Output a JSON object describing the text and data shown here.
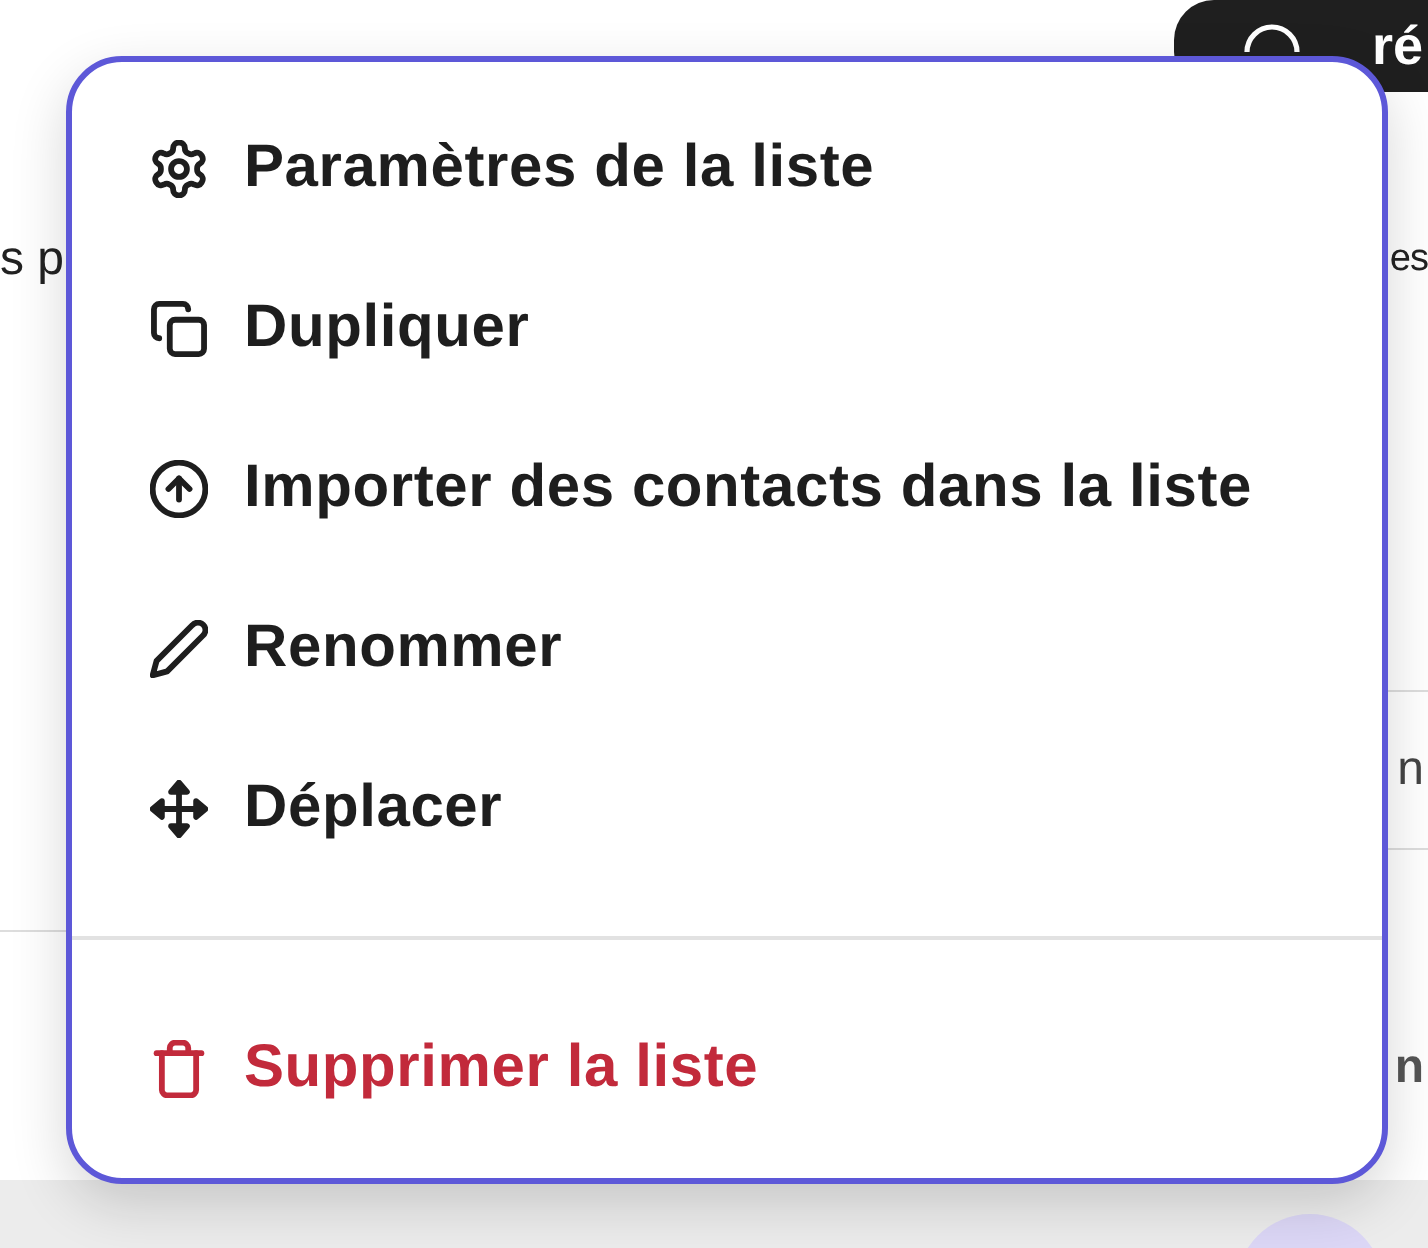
{
  "header": {
    "button_label": "ré"
  },
  "page_text": [
    "s p",
    "es"
  ],
  "table": {
    "rows": [
      {
        "cell": "n",
        "kind": "plain"
      },
      {
        "cell": "n",
        "kind": "bold"
      }
    ]
  },
  "menu": {
    "sections": [
      {
        "items": [
          {
            "label": "Paramètres de la liste",
            "kind": "default"
          },
          {
            "label": "Dupliquer",
            "kind": "default"
          },
          {
            "label": "Importer des contacts dans la liste",
            "kind": "default"
          },
          {
            "label": "Renommer",
            "kind": "default"
          },
          {
            "label": "Déplacer",
            "kind": "default"
          }
        ]
      },
      {
        "items": [
          {
            "label": "Supprimer la liste",
            "kind": "danger"
          }
        ]
      }
    ]
  }
}
